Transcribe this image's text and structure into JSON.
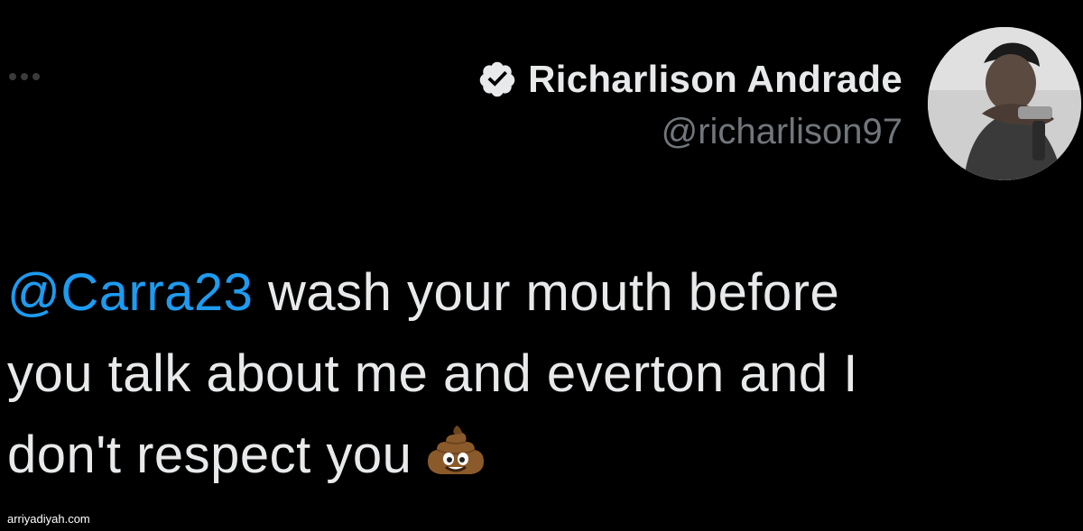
{
  "header": {
    "display_name": "Richarlison Andrade",
    "handle": "@richarlison97",
    "verified_icon": "verified-badge-icon",
    "more_icon": "more-options-icon"
  },
  "avatar": {
    "icon": "profile-photo"
  },
  "tweet": {
    "mention": "@Carra23",
    "line1_rest": " wash your mouth before",
    "line2": "you talk about me and everton and I",
    "line3": "don't respect you",
    "emoji": "pile-of-poo-emoji"
  },
  "watermark": "arriyadiyah.com",
  "colors": {
    "background": "#000000",
    "text": "#e7e9ea",
    "handle": "#71767b",
    "mention": "#1d9bf0"
  }
}
